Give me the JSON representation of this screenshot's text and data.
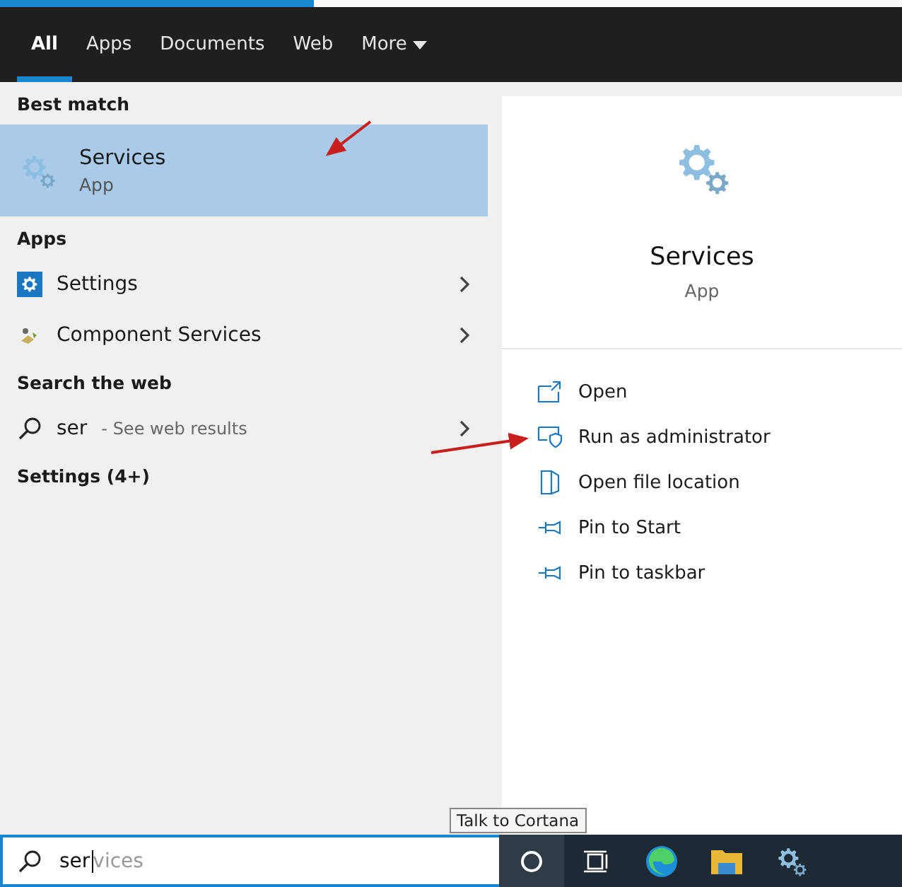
{
  "tabs": [
    {
      "label": "All",
      "selected": true
    },
    {
      "label": "Apps",
      "selected": false
    },
    {
      "label": "Documents",
      "selected": false
    },
    {
      "label": "Web",
      "selected": false
    },
    {
      "label": "More",
      "selected": false,
      "kind": "dropdown"
    }
  ],
  "results": [
    {
      "heading": "Best match",
      "items": [
        {
          "kind": "best",
          "title": "Services",
          "subtitle": "App",
          "selected": true
        }
      ]
    },
    {
      "heading": "Apps",
      "items": [
        {
          "kind": "app",
          "title": "Settings",
          "selected": false
        },
        {
          "kind": "app",
          "title": "Component Services",
          "selected": false
        }
      ]
    },
    {
      "heading": "Search the web",
      "items": [
        {
          "kind": "web",
          "title": "ser",
          "subtitle": "- See web results",
          "selected": false
        }
      ]
    },
    {
      "heading": "Settings (4+)"
    }
  ],
  "detail": {
    "title": "Services",
    "subtitle": "App",
    "actions": [
      {
        "label": "Open"
      },
      {
        "label": "Run as administrator"
      },
      {
        "label": "Open file location"
      },
      {
        "label": "Pin to Start"
      },
      {
        "label": "Pin to taskbar"
      }
    ]
  },
  "taskbar": {
    "search": {
      "value": "ser",
      "completion": "vices"
    },
    "tooltip": "Talk to Cortana"
  }
}
